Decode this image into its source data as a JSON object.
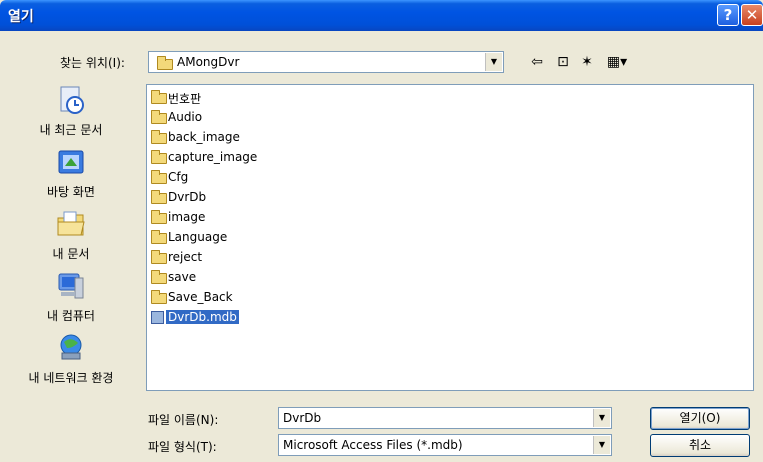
{
  "window": {
    "title": "열기",
    "help_glyph": "?",
    "close_glyph": "✕"
  },
  "lookin": {
    "label": "찾는 위치(I):",
    "value": "AMongDvr"
  },
  "toolbar": {
    "back_glyph": "⇦",
    "up_glyph": "⊡",
    "newfolder_glyph": "✶",
    "views_glyph": "▦▾"
  },
  "places": [
    {
      "label": "내 최근 문서",
      "icon": "recent-documents-icon"
    },
    {
      "label": "바탕 화면",
      "icon": "desktop-icon"
    },
    {
      "label": "내 문서",
      "icon": "my-documents-icon"
    },
    {
      "label": "내 컴퓨터",
      "icon": "my-computer-icon"
    },
    {
      "label": "내 네트워크 환경",
      "icon": "network-icon"
    }
  ],
  "files": [
    {
      "name": "번호판",
      "type": "folder"
    },
    {
      "name": "Audio",
      "type": "folder"
    },
    {
      "name": "back_image",
      "type": "folder"
    },
    {
      "name": "capture_image",
      "type": "folder"
    },
    {
      "name": "Cfg",
      "type": "folder"
    },
    {
      "name": "DvrDb",
      "type": "folder"
    },
    {
      "name": "image",
      "type": "folder"
    },
    {
      "name": "Language",
      "type": "folder"
    },
    {
      "name": "reject",
      "type": "folder"
    },
    {
      "name": "save",
      "type": "folder"
    },
    {
      "name": "Save_Back",
      "type": "folder"
    },
    {
      "name": "DvrDb.mdb",
      "type": "file",
      "selected": true
    }
  ],
  "filename": {
    "label": "파일 이름(N):",
    "value": "DvrDb"
  },
  "filetype": {
    "label": "파일 형식(T):",
    "value": "Microsoft Access Files (*.mdb)"
  },
  "buttons": {
    "open": "열기(O)",
    "cancel": "취소"
  },
  "dropdown_glyph": "▼"
}
